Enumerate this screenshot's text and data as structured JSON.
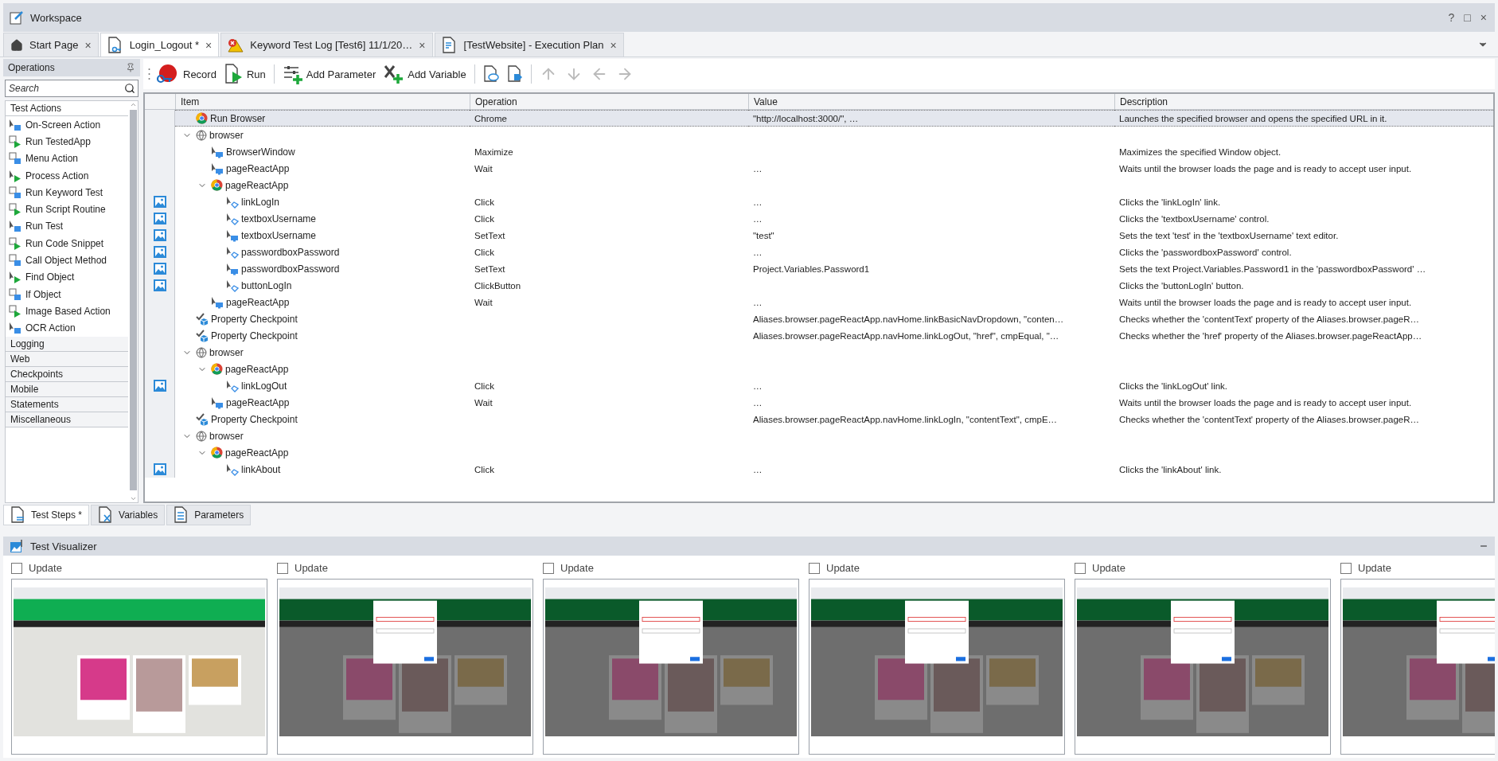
{
  "window": {
    "title": "Workspace",
    "controls": [
      "?",
      "□",
      "×"
    ]
  },
  "tabs": [
    {
      "label": "Start Page",
      "selected": false,
      "kind": "home",
      "close": "×"
    },
    {
      "label": "Login_Logout *",
      "selected": true,
      "kind": "keyword",
      "close": "×"
    },
    {
      "label": "Keyword Test Log [Test6] 11/1/20…",
      "selected": false,
      "kind": "log",
      "close": "×"
    },
    {
      "label": "[TestWebsite] - Execution Plan",
      "selected": false,
      "kind": "plan",
      "close": "×"
    }
  ],
  "operations": {
    "title": "Operations",
    "search": {
      "placeholder": "Search"
    },
    "sections": [
      {
        "label": "Test Actions",
        "expanded": true,
        "items": [
          "On-Screen Action",
          "Run TestedApp",
          "Menu Action",
          "Process Action",
          "Run Keyword Test",
          "Run Script Routine",
          "Run Test",
          "Run Code Snippet",
          "Call Object Method",
          "Find Object",
          "If Object",
          "Image Based Action",
          "OCR Action"
        ]
      },
      {
        "label": "Logging",
        "expanded": false
      },
      {
        "label": "Web",
        "expanded": false
      },
      {
        "label": "Checkpoints",
        "expanded": false
      },
      {
        "label": "Mobile",
        "expanded": false
      },
      {
        "label": "Statements",
        "expanded": false
      },
      {
        "label": "Miscellaneous",
        "expanded": false
      }
    ]
  },
  "toolbar": {
    "buttons": [
      {
        "label": "Record",
        "kind": "record"
      },
      {
        "label": "Run",
        "kind": "run"
      },
      {
        "label": "Add Parameter",
        "kind": "parameter"
      },
      {
        "label": "Add Variable",
        "kind": "variable"
      }
    ],
    "icon_buttons": [
      {
        "kind": "comment",
        "disabled": false
      },
      {
        "kind": "tag",
        "disabled": false
      },
      {
        "kind": "up",
        "disabled": true
      },
      {
        "kind": "down",
        "disabled": true
      },
      {
        "kind": "left",
        "disabled": true
      },
      {
        "kind": "right",
        "disabled": true
      }
    ]
  },
  "table": {
    "columns": [
      "Item",
      "Operation",
      "Value",
      "Description"
    ],
    "rows": [
      {
        "item": "Run Browser",
        "kind": "chrome",
        "operation": "Chrome",
        "value": "\"http://localhost:3000/\", …",
        "description": "Launches the specified browser and opens the specified URL in it.",
        "selected": true
      },
      {
        "item": "browser",
        "kind": "globe",
        "expanded": true,
        "selected": false,
        "children": [
          {
            "item": "BrowserWindow",
            "kind": "screen",
            "operation": "Maximize",
            "description": "Maximizes the specified Window object.",
            "selected": false
          },
          {
            "item": "pageReactApp",
            "kind": "screen",
            "operation": "Wait",
            "value": "…",
            "description": "Waits until the browser loads the page and is ready to accept user input.",
            "selected": false
          },
          {
            "item": "pageReactApp",
            "kind": "chrome",
            "expanded": true,
            "selected": false,
            "children": [
              {
                "item": "linkLogIn",
                "kind": "click",
                "operation": "Click",
                "value": "…",
                "description": "Clicks the 'linkLogIn' link.",
                "screenshot": true,
                "selected": false
              },
              {
                "item": "textboxUsername",
                "kind": "click",
                "operation": "Click",
                "value": "…",
                "description": "Clicks the 'textboxUsername' control.",
                "screenshot": true,
                "selected": false
              },
              {
                "item": "textboxUsername",
                "kind": "screen",
                "operation": "SetText",
                "value": "\"test\"",
                "description": "Sets the text 'test' in the 'textboxUsername' text editor.",
                "screenshot": true,
                "selected": false
              },
              {
                "item": "passwordboxPassword",
                "kind": "click",
                "operation": "Click",
                "value": "…",
                "description": "Clicks the 'passwordboxPassword' control.",
                "screenshot": true,
                "selected": false
              },
              {
                "item": "passwordboxPassword",
                "kind": "screen",
                "operation": "SetText",
                "value": "Project.Variables.Password1",
                "description": "Sets the text Project.Variables.Password1 in the 'passwordboxPassword' …",
                "screenshot": true,
                "selected": false
              },
              {
                "item": "buttonLogIn",
                "kind": "click",
                "operation": "ClickButton",
                "description": "Clicks the 'buttonLogIn' button.",
                "screenshot": true,
                "selected": false
              }
            ]
          },
          {
            "item": "pageReactApp",
            "kind": "screen",
            "operation": "Wait",
            "value": "…",
            "description": "Waits until the browser loads the page and is ready to accept user input.",
            "selected": false
          }
        ]
      },
      {
        "item": "Property Checkpoint",
        "kind": "checkpoint",
        "value": "Aliases.browser.pageReactApp.navHome.linkBasicNavDropdown, \"conten…",
        "description": "Checks whether the 'contentText' property of the Aliases.browser.pageR…",
        "selected": false
      },
      {
        "item": "Property Checkpoint",
        "kind": "checkpoint",
        "value": "Aliases.browser.pageReactApp.navHome.linkLogOut, \"href\", cmpEqual, \"…",
        "description": "Checks whether the 'href' property of the Aliases.browser.pageReactApp…",
        "selected": false
      },
      {
        "item": "browser",
        "kind": "globe",
        "expanded": true,
        "selected": false,
        "children": [
          {
            "item": "pageReactApp",
            "kind": "chrome",
            "expanded": true,
            "selected": false,
            "children": [
              {
                "item": "linkLogOut",
                "kind": "click",
                "operation": "Click",
                "value": "…",
                "description": "Clicks the 'linkLogOut' link.",
                "screenshot": true,
                "selected": false
              }
            ]
          },
          {
            "item": "pageReactApp",
            "kind": "screen",
            "operation": "Wait",
            "value": "…",
            "description": "Waits until the browser loads the page and is ready to accept user input.",
            "selected": false
          }
        ]
      },
      {
        "item": "Property Checkpoint",
        "kind": "checkpoint",
        "value": "Aliases.browser.pageReactApp.navHome.linkLogIn, \"contentText\", cmpE…",
        "description": "Checks whether the 'contentText' property of the Aliases.browser.pageR…",
        "selected": false
      },
      {
        "item": "browser",
        "kind": "globe",
        "expanded": true,
        "selected": false,
        "children": [
          {
            "item": "pageReactApp",
            "kind": "chrome",
            "expanded": true,
            "selected": false,
            "children": [
              {
                "item": "linkAbout",
                "kind": "click",
                "operation": "Click",
                "value": "…",
                "description": "Clicks the 'linkAbout' link.",
                "screenshot": true,
                "selected": false
              }
            ]
          }
        ]
      }
    ]
  },
  "bottom_tabs": [
    {
      "label": "Test Steps *",
      "selected": true,
      "kind": "steps"
    },
    {
      "label": "Variables",
      "selected": false,
      "kind": "variables"
    },
    {
      "label": "Parameters",
      "selected": false,
      "kind": "parameters"
    }
  ],
  "visualizer": {
    "title": "Test Visualizer",
    "frames": [
      {
        "label": "Update",
        "checked": false,
        "kind": "home"
      },
      {
        "label": "Update",
        "checked": false,
        "kind": "login-dialog"
      },
      {
        "label": "Update",
        "checked": false,
        "kind": "login-dialog"
      },
      {
        "label": "Update",
        "checked": false,
        "kind": "login-dialog"
      },
      {
        "label": "Update",
        "checked": false,
        "kind": "login-dialog"
      },
      {
        "label": "Update",
        "checked": false,
        "kind": "login-dialog"
      }
    ]
  }
}
